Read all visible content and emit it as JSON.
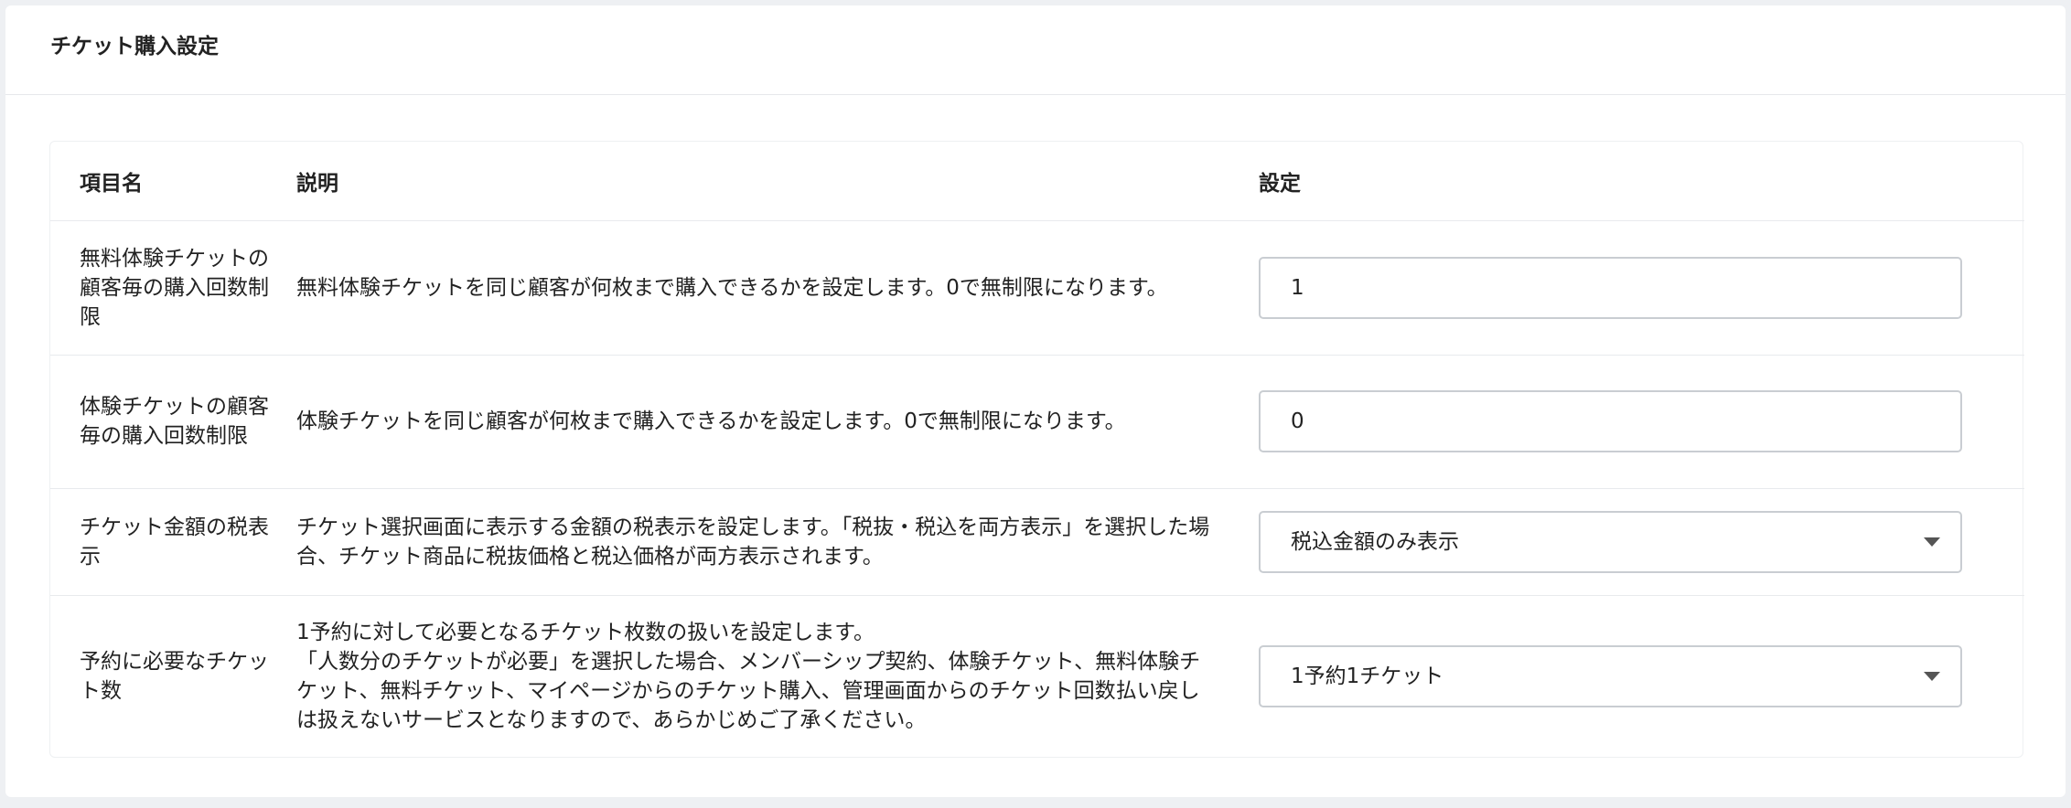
{
  "card": {
    "title": "チケット購入設定"
  },
  "table": {
    "headers": {
      "name": "項目名",
      "description": "説明",
      "setting": "設定"
    },
    "rows": [
      {
        "name": "無料体験チケットの顧客毎の購入回数制限",
        "description": "無料体験チケットを同じ顧客が何枚まで購入できるかを設定します。0で無制限になります。",
        "value": "1"
      },
      {
        "name": "体験チケットの顧客毎の購入回数制限",
        "description": "体験チケットを同じ顧客が何枚まで購入できるかを設定します。0で無制限になります。",
        "value": "0"
      },
      {
        "name": "チケット金額の税表示",
        "description": "チケット選択画面に表示する金額の税表示を設定します。「税抜・税込を両方表示」を選択した場合、チケット商品に税抜価格と税込価格が両方表示されます。",
        "value": "税込金額のみ表示"
      },
      {
        "name": "予約に必要なチケット数",
        "description_lines": [
          "1予約に対して必要となるチケット枚数の扱いを設定します。",
          "「人数分のチケットが必要」を選択した場合、メンバーシップ契約、体験チケット、無料体験チケット、無料チケット、マイページからのチケット購入、管理画面からのチケット回数払い戻しは扱えないサービスとなりますので、あらかじめご了承ください。"
        ],
        "value": "1予約1チケット"
      }
    ]
  },
  "icons": {
    "dropdown": "chevron-down-icon"
  }
}
